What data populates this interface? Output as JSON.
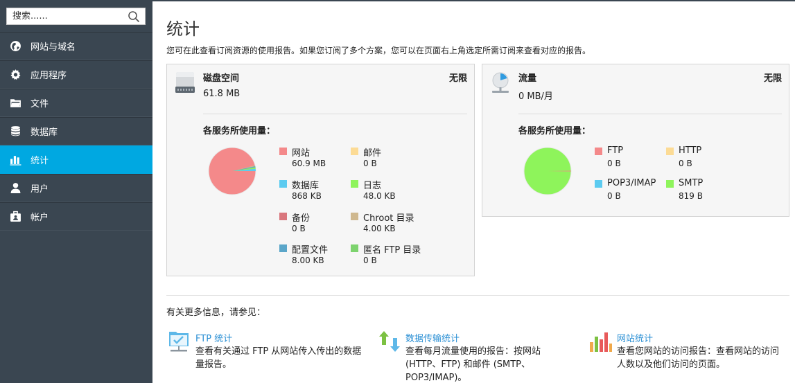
{
  "sidebar": {
    "search_placeholder": "搜索......",
    "items": [
      {
        "label": "网站与域名",
        "icon": "globe-icon"
      },
      {
        "label": "应用程序",
        "icon": "gear-icon"
      },
      {
        "label": "文件",
        "icon": "folder-icon"
      },
      {
        "label": "数据库",
        "icon": "database-icon"
      },
      {
        "label": "统计",
        "icon": "bar-chart-icon",
        "active": true
      },
      {
        "label": "用户",
        "icon": "user-icon"
      },
      {
        "label": "帐户",
        "icon": "account-icon"
      }
    ]
  },
  "page": {
    "title": "统计",
    "subtitle": "您可在此查看订阅资源的使用报告。如果您订阅了多个方案，您可以在页面右上角选定所需订阅来查看对应的报告。"
  },
  "disk": {
    "title": "磁盘空间",
    "limit": "无限",
    "value": "61.8 MB",
    "breakdown_title": "各服务所使用量：",
    "legend": [
      {
        "name": "网站",
        "value": "60.9 MB",
        "color": "#f4898a"
      },
      {
        "name": "邮件",
        "value": "0 B",
        "color": "#fcdb95"
      },
      {
        "name": "数据库",
        "value": "868 KB",
        "color": "#5ccbf0"
      },
      {
        "name": "日志",
        "value": "48.0 KB",
        "color": "#8ef45b"
      },
      {
        "name": "备份",
        "value": "0 B",
        "color": "#d9767d"
      },
      {
        "name": "Chroot 目录",
        "value": "4.00 KB",
        "color": "#cfb88f"
      },
      {
        "name": "配置文件",
        "value": "8.00 KB",
        "color": "#5ba6c9"
      },
      {
        "name": "匿名 FTP 目录",
        "value": "0 B",
        "color": "#7dd36e"
      }
    ]
  },
  "traffic": {
    "title": "流量",
    "limit": "无限",
    "value": "0 MB/月",
    "breakdown_title": "各服务所使用量：",
    "legend": [
      {
        "name": "FTP",
        "value": "0 B",
        "color": "#f4898a"
      },
      {
        "name": "HTTP",
        "value": "0 B",
        "color": "#fcdb95"
      },
      {
        "name": "POP3/IMAP",
        "value": "0 B",
        "color": "#5ccbf0"
      },
      {
        "name": "SMTP",
        "value": "819 B",
        "color": "#8ef45b"
      }
    ]
  },
  "more_info": {
    "title": "有关更多信息，请参见：",
    "links": [
      {
        "title": "FTP 统计",
        "desc_lines": [
          "查看有关通过 FTP 从网站传入传出的数据",
          "量报告。"
        ],
        "icon": "ftp-stats-icon"
      },
      {
        "title": "数据传输统计",
        "desc_lines": [
          "查看每月流量使用的报告：按网站",
          "(HTTP、FTP) 和邮件 (SMTP、",
          "POP3/IMAP)。"
        ],
        "icon": "transfer-stats-icon"
      },
      {
        "title": "网站统计",
        "desc_lines": [
          "查看您网站的访问报告：查看网站的访问",
          "人数以及他们访问的页面。"
        ],
        "icon": "web-stats-icon"
      }
    ]
  }
}
